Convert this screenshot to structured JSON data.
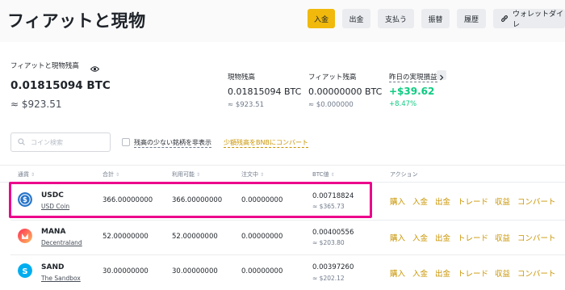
{
  "header": {
    "title": "フィアットと現物",
    "buttons": [
      {
        "label": "入金"
      },
      {
        "label": "出金"
      },
      {
        "label": "支払う"
      },
      {
        "label": "振替"
      },
      {
        "label": "履歴"
      },
      {
        "label": "ウォレットダイレ"
      }
    ]
  },
  "summary": {
    "total_label": "フィアットと現物残高",
    "total_btc": "0.01815094 BTC",
    "total_usd": "≈ $923.51",
    "spot_label": "現物残高",
    "spot_btc": "0.01815094 BTC",
    "spot_usd": "≈ $923.51",
    "fiat_label": "フィアット残高",
    "fiat_btc": "0.00000000 BTC",
    "fiat_usd": "≈ $0.000000",
    "pnl_label": "昨日の実現損益",
    "pnl_value": "+$39.62",
    "pnl_pct": "+8.47%",
    "positive_color": "#0ecb81"
  },
  "filters": {
    "search_placeholder": "コイン検索",
    "hide_small_label": "残高の少ない銘柄を非表示",
    "convert_link": "少額残高をBNBにコンバート"
  },
  "table": {
    "headers": [
      "通貨",
      "合計",
      "利用可能",
      "注文中",
      "BTC値",
      "アクション"
    ],
    "rows": [
      {
        "symbol": "USDC",
        "name": "USD Coin",
        "total": "366.00000000",
        "available": "366.00000000",
        "in_order": "0.00000000",
        "btc_value": "0.00718824",
        "usd_value": "≈ $365.73",
        "icon": "usdc-coin-icon"
      },
      {
        "symbol": "MANA",
        "name": "Decentraland",
        "total": "52.00000000",
        "available": "52.00000000",
        "in_order": "0.00000000",
        "btc_value": "0.00400556",
        "usd_value": "≈ $203.80",
        "icon": "mana-coin-icon"
      },
      {
        "symbol": "SAND",
        "name": "The Sandbox",
        "total": "30.00000000",
        "available": "30.00000000",
        "in_order": "0.00000000",
        "btc_value": "0.00397260",
        "usd_value": "≈ $202.12",
        "icon": "sand-coin-icon"
      }
    ],
    "actions": [
      "購入",
      "入金",
      "出金",
      "トレード",
      "収益",
      "コンバート"
    ]
  },
  "colors": {
    "accent": "#f0b90b",
    "link": "#c99400",
    "highlight": "#ec008c"
  }
}
